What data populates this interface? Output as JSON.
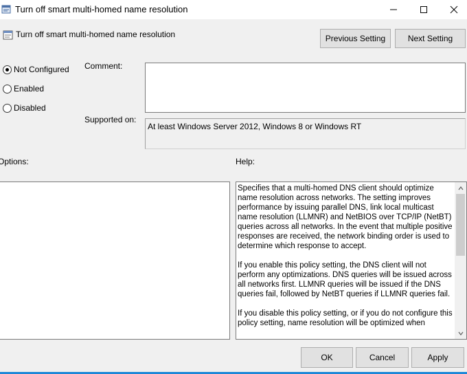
{
  "window": {
    "title": "Turn off smart multi-homed name resolution",
    "minimize_icon": "minimize-icon",
    "maximize_icon": "maximize-icon",
    "close_icon": "close-icon"
  },
  "header": {
    "title": "Turn off smart multi-homed name resolution",
    "icon": "policy-setting-icon"
  },
  "nav": {
    "previous_label": "Previous Setting",
    "next_label": "Next Setting"
  },
  "state": {
    "options": [
      {
        "label": "Not Configured",
        "checked": true
      },
      {
        "label": "Enabled",
        "checked": false
      },
      {
        "label": "Disabled",
        "checked": false
      }
    ]
  },
  "comment": {
    "label": "Comment:",
    "value": ""
  },
  "supported": {
    "label": "Supported on:",
    "value": "At least Windows Server 2012, Windows 8 or Windows RT"
  },
  "options_panel": {
    "label": "Options:"
  },
  "help_panel": {
    "label": "Help:",
    "paragraphs": [
      "Specifies that a multi-homed DNS client should optimize name resolution across networks. The setting improves performance by issuing parallel DNS, link local multicast name resolution (LLMNR) and NetBIOS over TCP/IP (NetBT) queries across all networks. In the event that multiple positive responses are received, the network binding order is used to determine which response to accept.",
      "If you enable this policy setting, the DNS client will not perform any optimizations. DNS queries will be issued across all networks first. LLMNR queries will be issued if the DNS queries fail, followed by NetBT queries if LLMNR queries fail.",
      "If you disable this policy setting, or if you do not configure this policy setting, name resolution will be optimized when"
    ]
  },
  "footer": {
    "ok_label": "OK",
    "cancel_label": "Cancel",
    "apply_label": "Apply"
  },
  "colors": {
    "window_bg": "#f0f0f0",
    "button_bg": "#e1e1e1",
    "accent": "#1c87d7"
  }
}
